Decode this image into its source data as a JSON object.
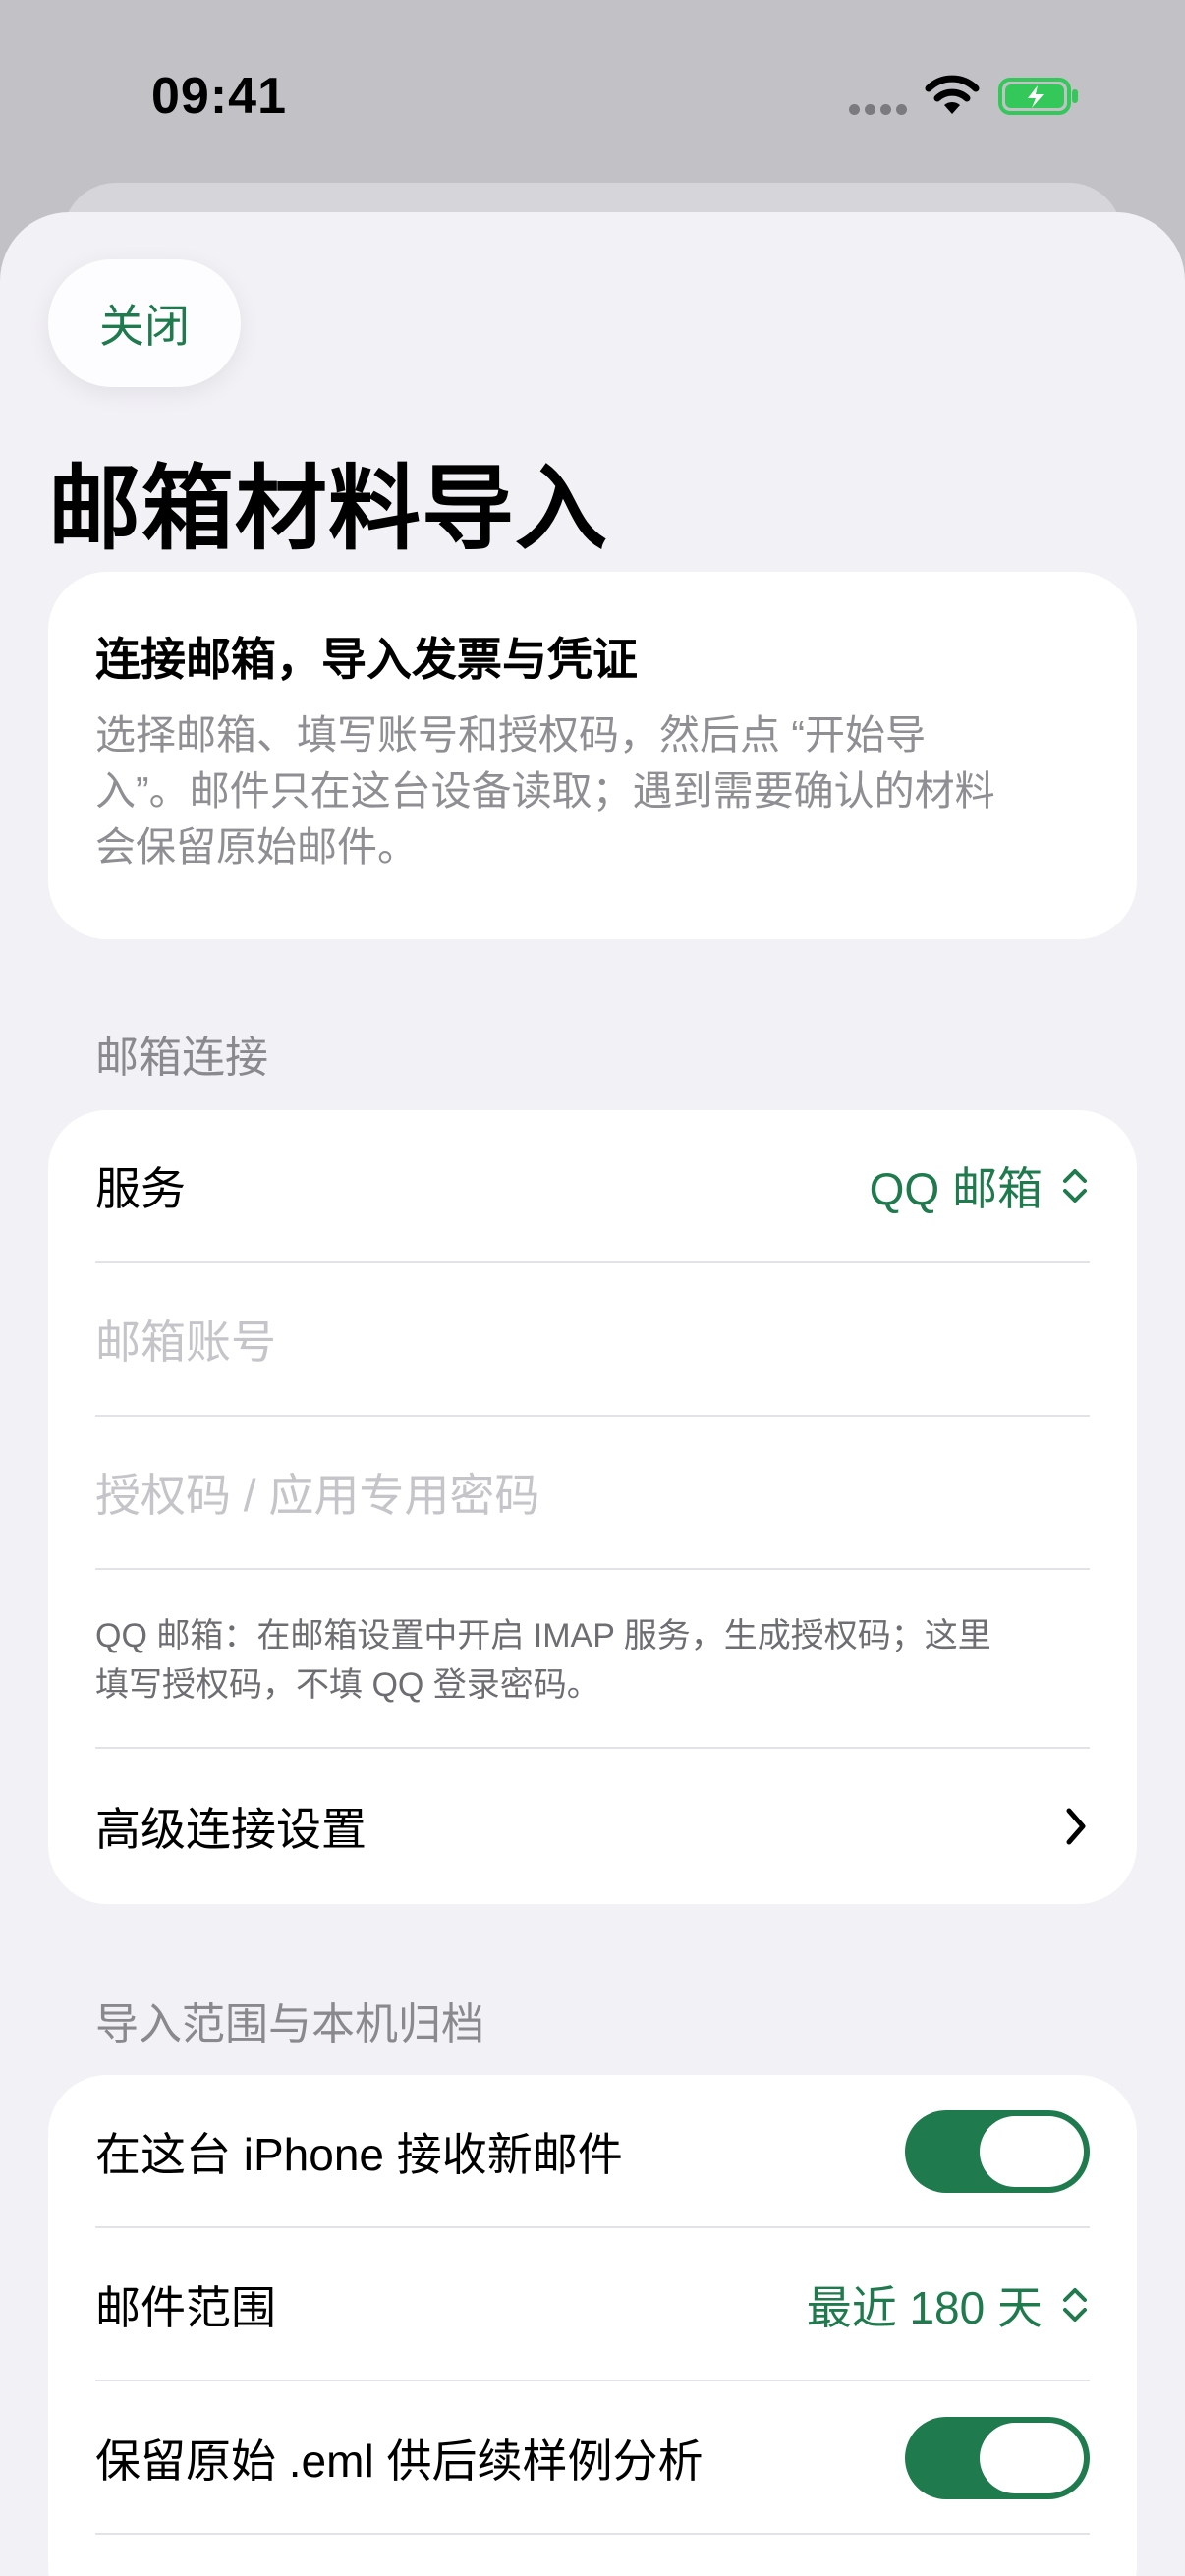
{
  "status_bar": {
    "time": "09:41"
  },
  "header": {
    "close_label": "关闭",
    "title": "邮箱材料导入"
  },
  "intro": {
    "title": "连接邮箱，导入发票与凭证",
    "body_lines": [
      "选择邮箱、填写账号和授权码，然后点 “开始导",
      "入”。邮件只在这台设备读取；遇到需要确认的材料",
      "会保留原始邮件。"
    ]
  },
  "connection": {
    "header": "邮箱连接",
    "service_label": "服务",
    "service_value": "QQ 邮箱",
    "account_placeholder": "邮箱账号",
    "auth_placeholder": "授权码 / 应用专用密码",
    "hint_lines": [
      "QQ 邮箱：在邮箱设置中开启 IMAP 服务，生成授权码；这里",
      "填写授权码，不填 QQ 登录密码。"
    ],
    "advanced_label": "高级连接设置"
  },
  "scope": {
    "header": "导入范围与本机归档",
    "receive_label": "在这台 iPhone 接收新邮件",
    "receive_on": true,
    "range_label": "邮件范围",
    "range_value": "最近 180 天",
    "keep_eml_label": "保留原始 .eml 供后续样例分析",
    "keep_eml_on": true
  },
  "colors": {
    "accent": "#1f7a4d",
    "background": "#f2f1f6",
    "card": "#ffffff"
  }
}
